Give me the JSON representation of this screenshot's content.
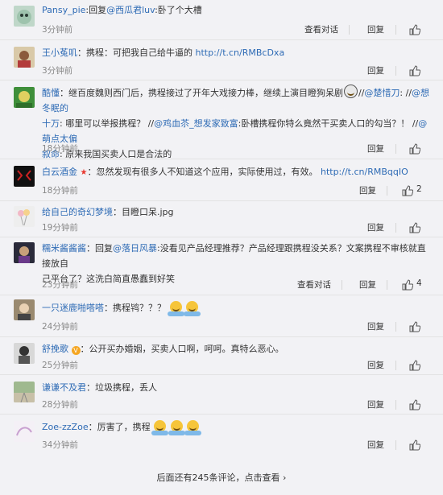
{
  "comments": [
    {
      "user": "Pansy_pie",
      "parts": [
        ":",
        "回复",
        "@西瓜君luv",
        ":卧了个大槽"
      ],
      "time": "3分钟前",
      "view": "查看对话",
      "reply": "回复",
      "likes": ""
    },
    {
      "user": "王小菟叽",
      "parts": [
        "：携程：可把我自己给牛逼的 ",
        "http://t.cn/RMBcDxa"
      ],
      "time": "3分钟前",
      "reply": "回复",
      "likes": ""
    },
    {
      "user": "酷懂",
      "line1": "：继百度魏则西门后，携程接过了开年大戏接力棒，继续上演目瞪狗呆剧",
      "l1_sep": "//",
      "l1_m1": "@楚惜刀",
      "l1_sep2": ": //",
      "l1_m2": "@想冬眠的",
      "line2a": "十万",
      "line2b": ": 哪里可以举报携程？ //",
      "line2c": "@鸡血苶_想发家致富",
      "line2d": ":卧槽携程你特么竟然干买卖人口的勾当？！ //",
      "line2e": "@萌点太偏",
      "line3a": "叙命",
      "line3b": ": 原来我国买卖人口是合法的",
      "time": "18分钟前",
      "reply": "回复",
      "likes": ""
    },
    {
      "user": "白云酒金",
      "text": "：忽然发现有很多人不知道这个应用，实际使用过，有效。 ",
      "link": "http://t.cn/RMBqqIO",
      "time": "18分钟前",
      "reply": "回复",
      "likes": "2"
    },
    {
      "user": "给自己的奇幻梦境",
      "text": "：目瞪口呆.jpg",
      "time": "19分钟前",
      "reply": "回复",
      "likes": ""
    },
    {
      "user": "糯米酱酱酱",
      "line1a": "：回复",
      "line1b": "@落日风暴",
      "line1c": ":没看见产品经理推荐？产品经理跟携程没关系？文案携程不审核就直接放自",
      "line2": "己平台了？这洗白简直愚蠢到好笑",
      "time": "23分钟前",
      "view": "查看对话",
      "reply": "回复",
      "likes": "4"
    },
    {
      "user": "一只迷鹿啪嗒嗒",
      "text": "：携程鸨？？？",
      "time": "24分钟前",
      "reply": "回复",
      "likes": ""
    },
    {
      "user": "舒挽歌",
      "text": "：公开买办婚姻，买卖人口啊，呵呵。真特么恶心。",
      "time": "25分钟前",
      "reply": "回复",
      "likes": ""
    },
    {
      "user": "谦谦不及君",
      "text": "：垃圾携程，丢人",
      "time": "28分钟前",
      "reply": "回复",
      "likes": ""
    },
    {
      "user": "Zoe-zzZoe",
      "text": "：厉害了，携程",
      "time": "34分钟前",
      "reply": "回复",
      "likes": ""
    }
  ],
  "footer": {
    "more_text": "后面还有245条评论，点击查看",
    "arrow": "›"
  },
  "colors": {
    "link": "#2e6bb5",
    "background": "#f2f2f5"
  }
}
